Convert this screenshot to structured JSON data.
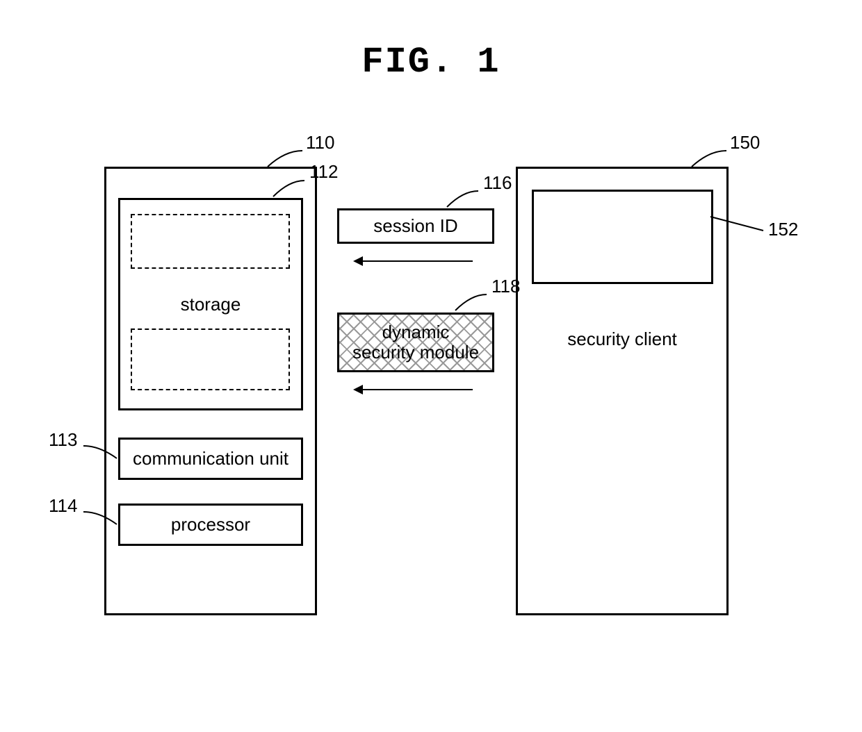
{
  "title": "FIG. 1",
  "refs": {
    "r110": "110",
    "r112": "112",
    "r113": "113",
    "r114": "114",
    "r116": "116",
    "r118": "118",
    "r150": "150",
    "r152": "152"
  },
  "labels": {
    "storage": "storage",
    "comm_unit": "communication unit",
    "processor": "processor",
    "session_id": "session ID",
    "dynamic1": "dynamic",
    "dynamic2": "security module",
    "security_client": "security client"
  }
}
